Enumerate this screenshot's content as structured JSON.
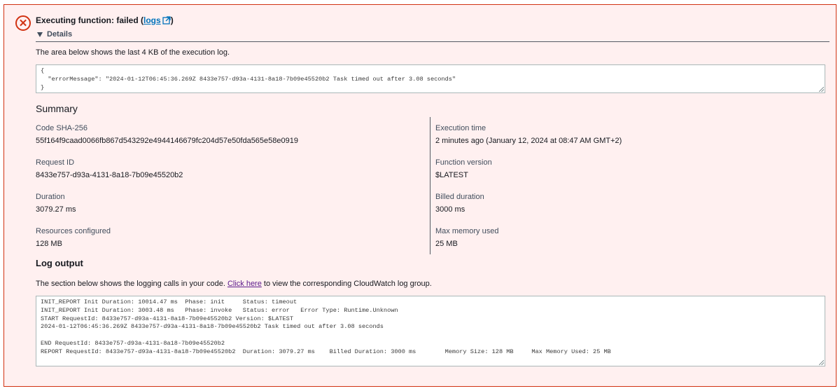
{
  "header": {
    "title_prefix": "Executing function: failed (",
    "logs_link": "logs",
    "title_suffix": ")",
    "details_label": "Details"
  },
  "execution": {
    "description": "The area below shows the last 4 KB of the execution log.",
    "log_lines": [
      "{",
      "  \"errorMessage\": \"2024-01-12T06:45:36.269Z 8433e757-d93a-4131-8a18-7b09e45520b2 Task timed out after 3.08 seconds\"",
      "}"
    ]
  },
  "summary": {
    "title": "Summary",
    "left": [
      {
        "label": "Code SHA-256",
        "value": "55f164f9caad0066fb867d543292e4944146679fc204d57e50fda565e58e0919"
      },
      {
        "label": "Request ID",
        "value": "8433e757-d93a-4131-8a18-7b09e45520b2"
      },
      {
        "label": "Duration",
        "value": "3079.27 ms"
      },
      {
        "label": "Resources configured",
        "value": "128 MB"
      }
    ],
    "right": [
      {
        "label": "Execution time",
        "value": "2 minutes ago (January 12, 2024 at 08:47 AM GMT+2)"
      },
      {
        "label": "Function version",
        "value": "$LATEST"
      },
      {
        "label": "Billed duration",
        "value": "3000 ms"
      },
      {
        "label": "Max memory used",
        "value": "25 MB"
      }
    ]
  },
  "log_output": {
    "title": "Log output",
    "desc_prefix": "The section below shows the logging calls in your code. ",
    "link": "Click here",
    "desc_suffix": " to view the corresponding CloudWatch log group.",
    "lines": [
      "INIT_REPORT Init Duration: 10014.47 ms  Phase: init     Status: timeout",
      "INIT_REPORT Init Duration: 3003.48 ms   Phase: invoke   Status: error   Error Type: Runtime.Unknown",
      "START RequestId: 8433e757-d93a-4131-8a18-7b09e45520b2 Version: $LATEST",
      "2024-01-12T06:45:36.269Z 8433e757-d93a-4131-8a18-7b09e45520b2 Task timed out after 3.08 seconds",
      "",
      "END RequestId: 8433e757-d93a-4131-8a18-7b09e45520b2",
      "REPORT RequestId: 8433e757-d93a-4131-8a18-7b09e45520b2  Duration: 3079.27 ms    Billed Duration: 3000 ms        Memory Size: 128 MB     Max Memory Used: 25 MB"
    ]
  },
  "colors": {
    "error": "#d13212",
    "link": "#0073bb",
    "visited_link": "#5a1a8b",
    "alert_bg": "#fff0f0"
  }
}
